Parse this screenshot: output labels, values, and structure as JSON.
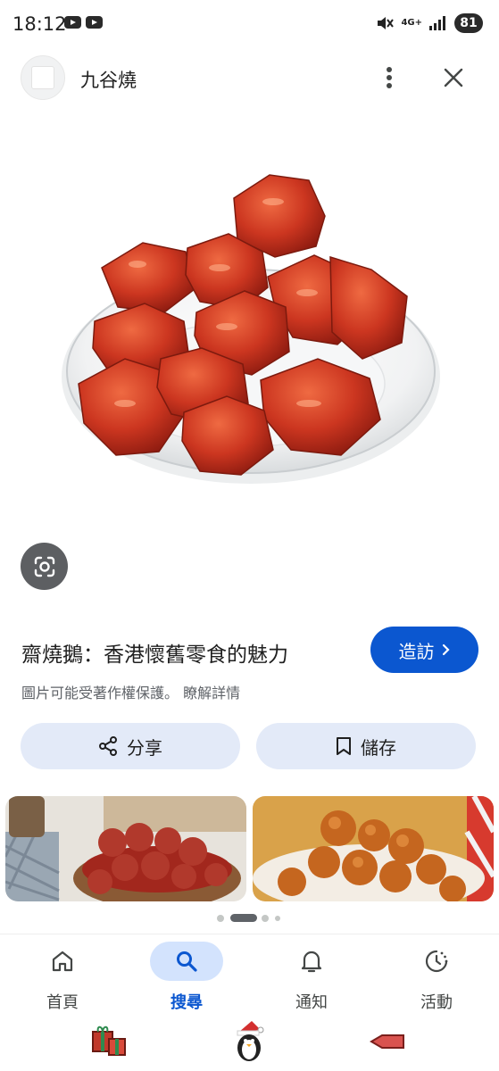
{
  "status_bar": {
    "time": "18:12",
    "network": "4G+",
    "battery": "81"
  },
  "header": {
    "site_title": "九谷燒"
  },
  "result": {
    "title": "齋燒鵝：香港懷舊零食的魅力",
    "visit_label": "造訪",
    "copyright_notice": "圖片可能受著作權保護。",
    "learn_more": "瞭解詳情"
  },
  "actions": {
    "share_label": "分享",
    "save_label": "儲存"
  },
  "pagination": {
    "page_count": 5,
    "active_index": 1
  },
  "bottom_nav": {
    "items": [
      {
        "label": "首頁",
        "icon": "home-icon"
      },
      {
        "label": "搜尋",
        "icon": "search-icon",
        "active": true
      },
      {
        "label": "通知",
        "icon": "bell-icon"
      },
      {
        "label": "活動",
        "icon": "activity-icon"
      }
    ]
  },
  "colors": {
    "accent": "#0b57d0",
    "button_bg": "#e3eaf8",
    "nav_active_bg": "#d3e3fd",
    "food_red": "#c8321e"
  }
}
